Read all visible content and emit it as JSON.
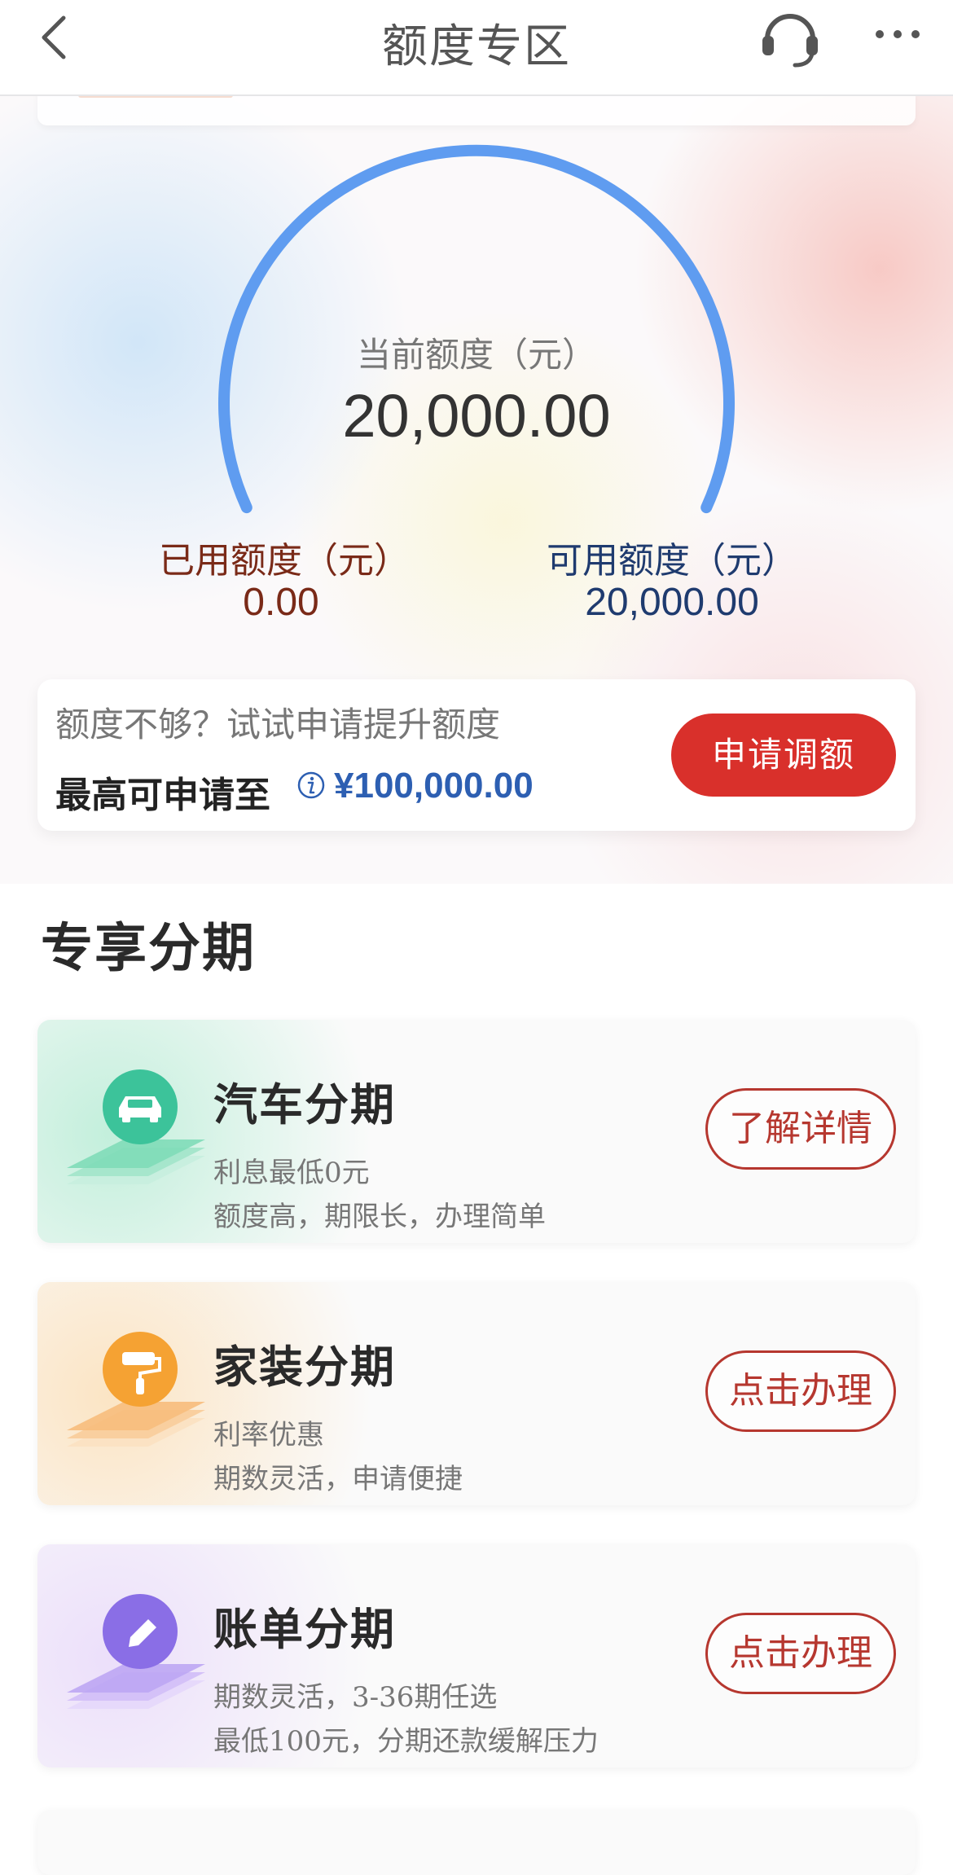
{
  "header": {
    "title": "额度专区"
  },
  "quota": {
    "current_label": "当前额度（元）",
    "current_value": "20,000.00",
    "used_label": "已用额度（元）",
    "used_value": "0.00",
    "available_label": "可用额度（元）",
    "available_value": "20,000.00",
    "gauge_color": "#5f9cf0"
  },
  "promo": {
    "hint": "额度不够？试试申请提升额度",
    "max_label": "最高可申请至",
    "max_value": "¥100,000.00",
    "button_label": "申请调额",
    "button_color": "#d9302b"
  },
  "section": {
    "title": "专享分期"
  },
  "products": [
    {
      "name": "汽车分期",
      "line1": "利息最低0元",
      "line2": "额度高，期限长，办理简单",
      "button": "了解详情",
      "icon": "car-icon",
      "accent": "#3cc39a"
    },
    {
      "name": "家装分期",
      "line1": "利率优惠",
      "line2": "期数灵活，申请便捷",
      "button": "点击办理",
      "icon": "paint-roller-icon",
      "accent": "#f5a233"
    },
    {
      "name": "账单分期",
      "line1": "期数灵活，3-36期任选",
      "line2": "最低100元，分期还款缓解压力",
      "button": "点击办理",
      "icon": "pencil-icon",
      "accent": "#8a6ee6"
    }
  ]
}
